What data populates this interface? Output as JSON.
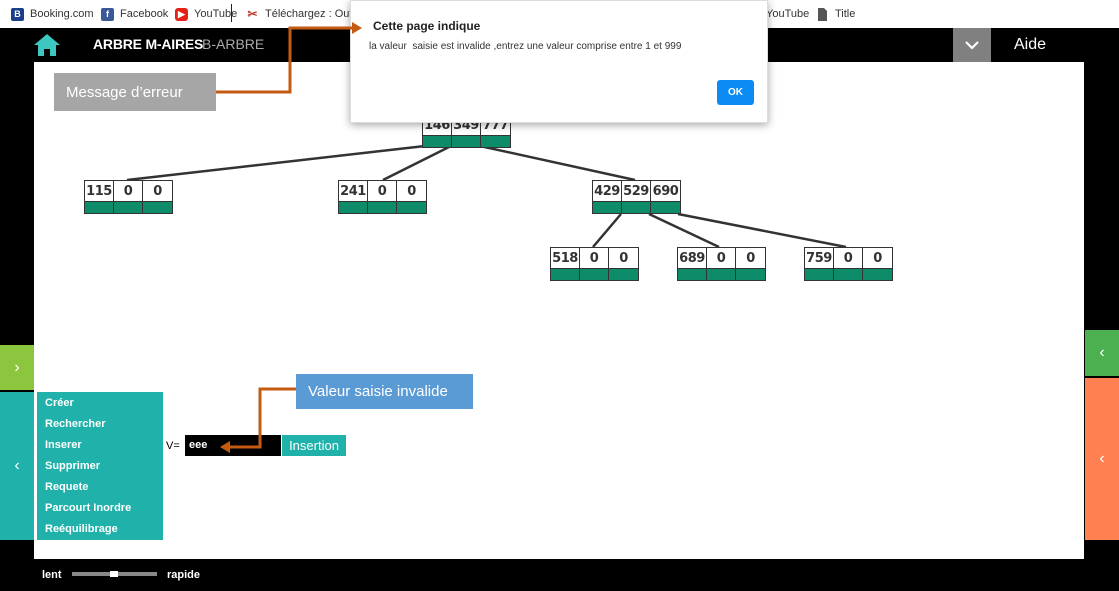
{
  "bookmarks": [
    {
      "label": "Booking.com",
      "icon": "booking-icon",
      "color": "#1a3e8c"
    },
    {
      "label": "Facebook",
      "icon": "facebook-icon",
      "color": "#3b5998"
    },
    {
      "label": "YouTube",
      "icon": "youtube-icon",
      "color": "#e62117"
    },
    {
      "label": "Téléchargez : Outils",
      "icon": "download-tool-icon",
      "color": "#c0392b"
    },
    {
      "label": "YouTube",
      "icon": "youtube-icon",
      "color": "#e62117"
    },
    {
      "label": "Title",
      "icon": "document-icon",
      "color": "#555555"
    }
  ],
  "header": {
    "title": "ARBRE M-AIRES",
    "subtitle": "B-ARBRE",
    "help_label": "Aide"
  },
  "dialog": {
    "title": "Cette page indique",
    "message": "la valeur  saisie est invalide ,entrez une valeur comprise entre 1 et 999",
    "ok_label": "OK"
  },
  "tree": {
    "root": [
      "146",
      "349",
      "777"
    ],
    "level1": [
      [
        "115",
        "0",
        "0"
      ],
      [
        "241",
        "0",
        "0"
      ],
      [
        "429",
        "529",
        "690"
      ]
    ],
    "level2": [
      [
        "518",
        "0",
        "0"
      ],
      [
        "689",
        "0",
        "0"
      ],
      [
        "759",
        "0",
        "0"
      ]
    ]
  },
  "menu": {
    "items": [
      "Créer",
      "Rechercher",
      "Inserer",
      "Supprimer",
      "Requete",
      "Parcourt Inordre",
      "Reéquilibrage"
    ]
  },
  "insert": {
    "label": "V=",
    "value": "eee",
    "button": "Insertion"
  },
  "annotations": {
    "error": "Message d’erreur",
    "invalid": "Valeur saisie invalide"
  },
  "speed": {
    "slow": "lent",
    "fast": "rapide"
  },
  "colors": {
    "teal": "#20b2aa",
    "node_green": "#0e8c6a",
    "arrow": "#c55a11",
    "callout_gray": "#a6a6a6",
    "callout_blue": "#5b9bd5",
    "side_lime": "#8cc63f",
    "side_green": "#4caf50",
    "side_orange": "#ff8050",
    "ok_blue": "#0b8cf5"
  }
}
